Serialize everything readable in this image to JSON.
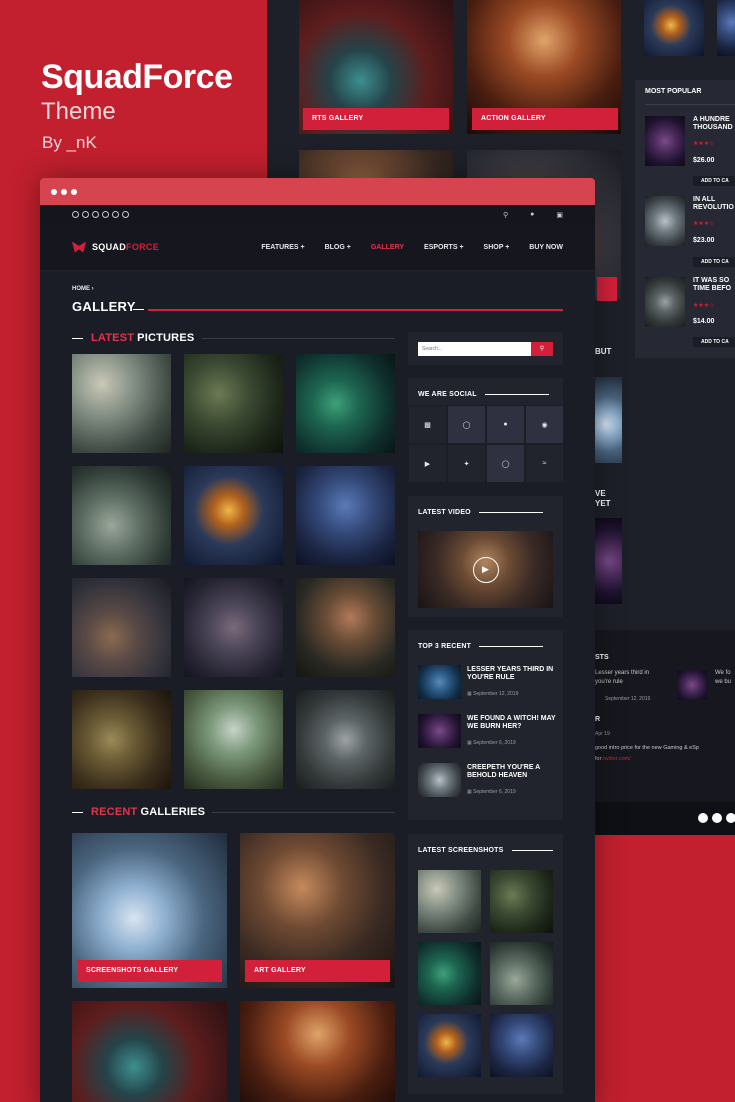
{
  "promo": {
    "title": "SquadForce",
    "subtitle": "Theme",
    "by": "By _nK"
  },
  "browser": {
    "logo": {
      "first": "SQUAD",
      "second": "FORCE"
    },
    "menu": [
      "FEATURES +",
      "BLOG +",
      "GALLERY",
      "ESPORTS +",
      "SHOP +",
      "BUY NOW"
    ],
    "active_menu": "GALLERY",
    "top_icons": [
      "search-icon",
      "user-icon",
      "cart-icon"
    ],
    "breadcrumb": "HOME",
    "page_title": "GALLERY",
    "latest": {
      "red": "LATEST",
      "rest": "PICTURES"
    },
    "recent": {
      "red": "RECENT",
      "rest": "GALLERIES"
    },
    "galleries": [
      "SCREENSHOTS GALLERY",
      "ART GALLERY"
    ],
    "sidebar": {
      "search_placeholder": "Search...",
      "social_title": "WE ARE SOCIAL",
      "social_icons": [
        "twitch-icon",
        "instagram-icon",
        "facebook-icon",
        "discord-icon",
        "youtube-icon",
        "twitter-icon",
        "instagram-icon",
        "rss-icon"
      ],
      "video_title": "LATEST VIDEO",
      "recent_title": "TOP 3 RECENT",
      "recent_items": [
        {
          "title": "LESSER YEARS THIRD IN YOU'RE RULE",
          "date": "September 12, 2019"
        },
        {
          "title": "WE FOUND A WITCH! MAY WE BURN HER?",
          "date": "September 6, 2019"
        },
        {
          "title": "CREEPETH YOU'RE A BEHOLD HEAVEN",
          "date": "September 6, 2019"
        }
      ],
      "screens_title": "LATEST SCREENSHOTS"
    }
  },
  "background": {
    "labels": [
      "RTS GALLERY",
      "ACTION GALLERY"
    ],
    "popular_title": "MOST POPULAR",
    "products": [
      {
        "title": "A HUNDRE THOUSAND",
        "price": "$26.00",
        "cta": "ADD TO CA"
      },
      {
        "title": "IN ALL REVOLUTIO",
        "price": "$23.00",
        "cta": "ADD TO CA"
      },
      {
        "title": "IT WAS SO TIME BEFO",
        "price": "$14.00",
        "cta": "ADD TO CA"
      }
    ],
    "fragments": {
      "but": "BUT",
      "ve": "VE",
      "yet": "YET",
      "sts": "STS",
      "r": "R",
      "line1": "Lesser years third in",
      "line2": "you're rule",
      "date1": "September 12, 2019",
      "line3": "We fo",
      "line4": "we bu",
      "date2": "Apr 19",
      "text1": "good intro price for the new",
      "text1b": "Gaming & eSp",
      "text2": "for",
      "link": "twitter.com/"
    }
  },
  "colors": {
    "accent": "#d3203a",
    "bg": "#c2202e",
    "dark": "#1b1d26",
    "panel": "#22242d"
  }
}
